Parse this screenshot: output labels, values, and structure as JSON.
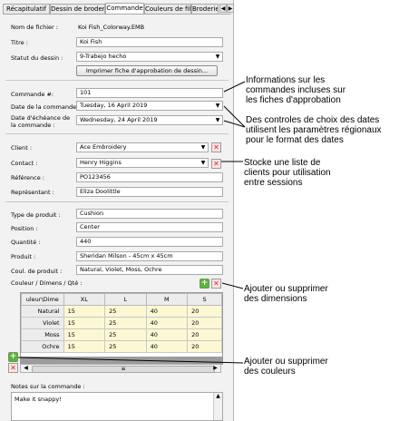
{
  "tabs": [
    {
      "label": "Récapitulatif"
    },
    {
      "label": "Dessin de broderie"
    },
    {
      "label": "Commande"
    },
    {
      "label": "Couleurs de fil"
    },
    {
      "label": "Broderie"
    }
  ],
  "design": {
    "filename_label": "Nom de fichier :",
    "filename_value": "Koi Fish_Colorway.EMB",
    "title_label": "Titre :",
    "title_value": "Koi Fish",
    "status_label": "Statut du dessin :",
    "status_value": "9-Trabejo hecho",
    "print_button": "Imprimer fiche d'approbation de dessin..."
  },
  "order": {
    "order_label": "Commande #:",
    "order_value": "101",
    "date_label": "Date de la commande :",
    "date_value": "Tuesday, 16 April 2019",
    "due_label_1": "Date d'échéance de",
    "due_label_2": "la commande :",
    "due_value": "Wednesday, 24 April 2019"
  },
  "client": {
    "client_label": "Client :",
    "client_value": "Ace Embroidery",
    "contact_label": "Contact :",
    "contact_value": "Henry Higgins",
    "ref_label": "Référence :",
    "ref_value": "PO123456",
    "rep_label": "Représentant :",
    "rep_value": "Eliza Doolittle"
  },
  "product": {
    "type_label": "Type de produit :",
    "type_value": "Cushion",
    "position_label": "Position :",
    "position_value": "Center",
    "qty_label": "Quantité :",
    "qty_value": "440",
    "product_label": "Produit :",
    "product_value": "Sheridan Milson - 45cm x 45cm",
    "colors_label": "Coul. de produit :",
    "colors_value": "Natural, Violet, Moss, Ochre",
    "grid_label": "Couleur / Dimens / Qté :"
  },
  "grid": {
    "corner": "uleur\\Dime",
    "columns": [
      "XL",
      "L",
      "M",
      "S"
    ],
    "rows": [
      {
        "name": "Natural",
        "values": [
          "15",
          "25",
          "40",
          "20"
        ]
      },
      {
        "name": "Violet",
        "values": [
          "15",
          "25",
          "40",
          "20"
        ]
      },
      {
        "name": "Moss",
        "values": [
          "15",
          "25",
          "40",
          "20"
        ]
      },
      {
        "name": "Ochre",
        "values": [
          "15",
          "25",
          "40",
          "20"
        ]
      }
    ]
  },
  "notes": {
    "label": "Notes sur la commande :",
    "value": "Make it snappy!"
  },
  "callouts": {
    "c1": [
      "Informations sur les",
      "commandes incluses sur",
      "les fiches d'approbation"
    ],
    "c2": [
      "Des controles de choix des dates",
      "utilisent les paramètres régionaux",
      "pour le format des dates"
    ],
    "c3": [
      "Stocke une liste de",
      "clients pour utilisation",
      "entre sessions"
    ],
    "c4": [
      "Ajouter ou supprimer",
      "des dimensions"
    ],
    "c5": [
      "Ajouter ou supprimer",
      "des couleurs"
    ]
  }
}
